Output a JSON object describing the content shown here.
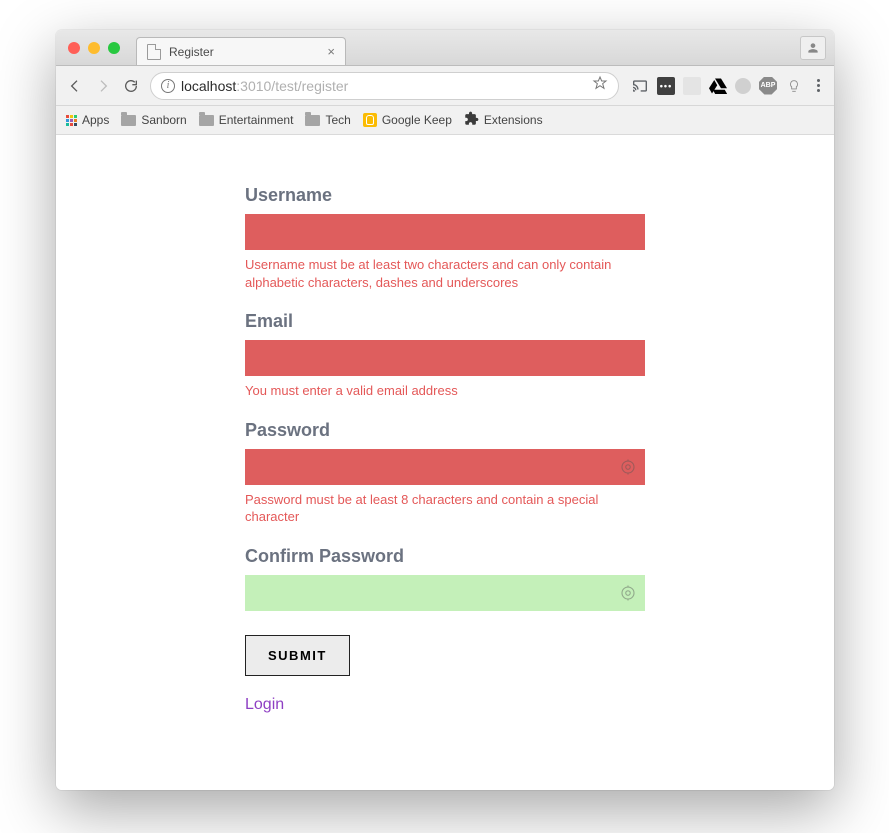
{
  "window": {
    "tab_title": "Register",
    "url_host": "localhost",
    "url_port_path": ":3010/test/register"
  },
  "bookmarks": {
    "apps": "Apps",
    "folders": [
      "Sanborn",
      "Entertainment",
      "Tech"
    ],
    "keep": "Google Keep",
    "extensions": "Extensions"
  },
  "extensions": {
    "abp_label": "ABP",
    "dash_label": "•••"
  },
  "form": {
    "username": {
      "label": "Username",
      "value": "",
      "error": "Username must be at least two characters and can only contain alphabetic characters, dashes and underscores"
    },
    "email": {
      "label": "Email",
      "value": "",
      "error": "You must enter a valid email address"
    },
    "password": {
      "label": "Password",
      "value": "",
      "error": "Password must be at least 8 characters and contain a special character"
    },
    "confirm": {
      "label": "Confirm Password",
      "value": ""
    },
    "submit_label": "SUBMIT",
    "login_link": "Login"
  }
}
